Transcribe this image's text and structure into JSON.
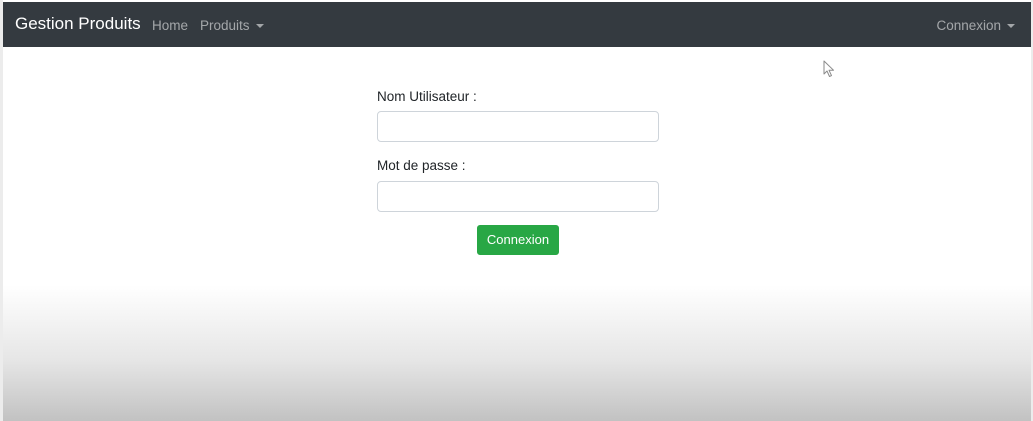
{
  "navbar": {
    "brand": "Gestion Produits",
    "items": [
      {
        "label": "Home"
      },
      {
        "label": "Produits",
        "has_dropdown": true
      }
    ],
    "right_item": {
      "label": "Connexion",
      "has_dropdown": true
    },
    "background_color": "#343a40"
  },
  "login_form": {
    "username_label": "Nom Utilisateur :",
    "username_value": "",
    "password_label": "Mot de passe :",
    "password_value": "",
    "submit_label": "Connexion",
    "submit_color": "#28a745"
  },
  "icons": {
    "dropdown": "caret-down-icon",
    "pointer": "mouse-cursor-icon"
  }
}
